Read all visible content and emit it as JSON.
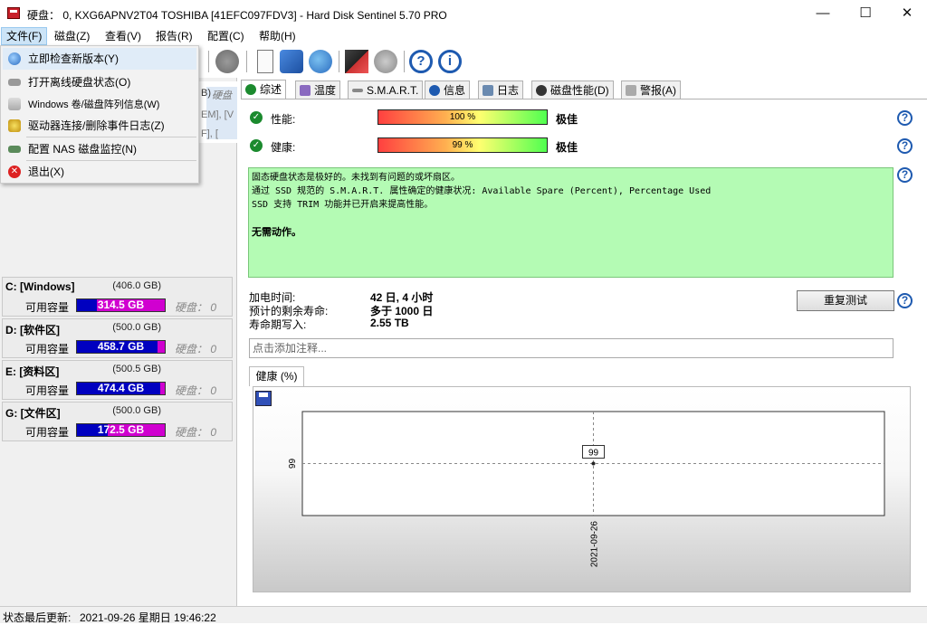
{
  "window": {
    "title": "硬盘：  0, KXG6APNV2T04 TOSHIBA [41EFC097FDV3]  -  Hard Disk Sentinel 5.70 PRO",
    "minimize": "—",
    "maximize": "☐",
    "close": "✕"
  },
  "menubar": {
    "items": [
      "文件(F)",
      "磁盘(Z)",
      "查看(V)",
      "报告(R)",
      "配置(C)",
      "帮助(H)"
    ]
  },
  "dropdown": {
    "items": [
      {
        "label": "立即检查新版本(Y)",
        "icon": "globe-icon"
      },
      {
        "label": "打开离线硬盘状态(O)",
        "icon": "disk-icon"
      },
      {
        "label": "Windows 卷/磁盘阵列信息(W)",
        "icon": "layers-icon"
      },
      {
        "label": "驱动器连接/删除事件日志(Z)",
        "icon": "gear-icon"
      },
      {
        "label": "配置 NAS 磁盘监控(N)",
        "icon": "nas-icon"
      },
      {
        "label": "退出(X)",
        "icon": "exit-icon"
      }
    ]
  },
  "drive_header": {
    "partial_1": "B)",
    "partial_1_italic": "硬盘",
    "partial_2": "EM],  [V",
    "partial_3": "F], ["
  },
  "partitions": [
    {
      "name": "C: [Windows]",
      "size": "(406.0 GB)",
      "free_label": "可用容量",
      "free": "314.5 GB",
      "free_fraction": 0.77,
      "disk": "硬盘：  0"
    },
    {
      "name": "D: [软件区]",
      "size": "(500.0 GB)",
      "free_label": "可用容量",
      "free": "458.7 GB",
      "free_fraction": 0.08,
      "disk": "硬盘：  0"
    },
    {
      "name": "E: [资料区]",
      "size": "(500.5 GB)",
      "free_label": "可用容量",
      "free": "474.4 GB",
      "free_fraction": 0.05,
      "disk": "硬盘：  0"
    },
    {
      "name": "G: [文件区]",
      "size": "(500.0 GB)",
      "free_label": "可用容量",
      "free": "172.5 GB",
      "free_fraction": 0.65,
      "disk": "硬盘：  0"
    }
  ],
  "tabs": [
    "综述",
    "温度",
    "S.M.A.R.T.",
    "信息",
    "日志",
    "磁盘性能(D)",
    "警报(A)"
  ],
  "overview": {
    "performance_label": "性能:",
    "performance_value": "100 %",
    "performance_rating": "极佳",
    "health_label": "健康:",
    "health_value": "99 %",
    "health_rating": "极佳",
    "status_lines": [
      "固态硬盘状态是极好的。未找到有问题的或坏扇区。",
      "通过 SSD 规范的 S.M.A.R.T. 属性确定的健康状况:   Available Spare (Percent), Percentage Used",
      "SSD 支持 TRIM 功能并已开启来提高性能。"
    ],
    "action": "无需动作。",
    "power_on_label": "加电时间:",
    "power_on_value": "42 日, 4 小时",
    "remaining_label": "预计的剩余寿命:",
    "remaining_value": "多于 1000 日",
    "writes_label": "寿命期写入:",
    "writes_value": "2.55 TB",
    "retest_button": "重复测试",
    "comment_placeholder": "点击添加注释..."
  },
  "chart_tab": "健康 (%)",
  "chart_data": {
    "type": "line",
    "title": "",
    "xlabel": "",
    "ylabel": "",
    "x": [
      "2021-09-26"
    ],
    "series": [
      {
        "values": [
          99
        ]
      }
    ],
    "data_labels": [
      "99"
    ],
    "y_ticks": [
      "99"
    ]
  },
  "statusbar": {
    "label": "状态最后更新:",
    "value": "2021-09-26 星期日 19:46:22"
  },
  "colors": {
    "status_bg": "#b4fbb4",
    "bar_used": "#0000c0",
    "bar_free": "#d000d0",
    "help_blue": "#1e5ab0"
  }
}
